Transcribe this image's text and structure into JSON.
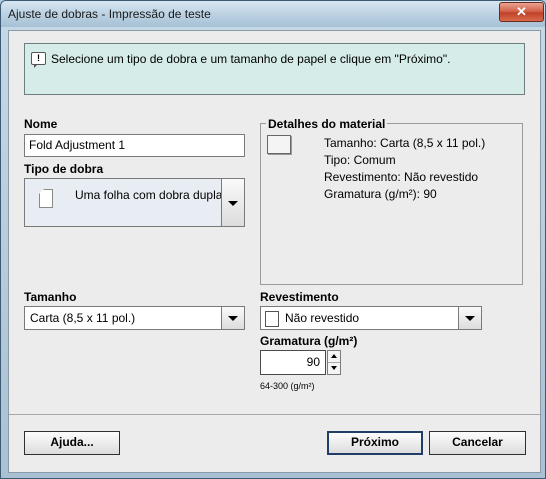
{
  "window": {
    "title": "Ajuste de dobras - Impressão de teste",
    "close_glyph": "✕"
  },
  "info": {
    "icon": "speech-bubble-info-icon",
    "message": "Selecione um tipo de dobra e um tamanho de papel e clique em \"Próximo\"."
  },
  "name": {
    "label": "Nome",
    "value": "Fold Adjustment 1"
  },
  "fold_type": {
    "label": "Tipo de dobra",
    "value": "Uma folha com dobra dupla",
    "icon": "folded-sheet-icon"
  },
  "material_details": {
    "label": "Detalhes do material",
    "size": "Tamanho: Carta (8,5 x 11 pol.)",
    "type": "Tipo: Comum",
    "coating": "Revestimento: Não revestido",
    "weight": "Gramatura (g/m²): 90"
  },
  "size": {
    "label": "Tamanho",
    "value": "Carta (8,5 x 11 pol.)"
  },
  "coating": {
    "label": "Revestimento",
    "value": "Não revestido"
  },
  "weight": {
    "label": "Gramatura (g/m²)",
    "value": "90",
    "range": "64-300 (g/m²)"
  },
  "buttons": {
    "help": "Ajuda...",
    "next": "Próximo",
    "cancel": "Cancelar"
  }
}
